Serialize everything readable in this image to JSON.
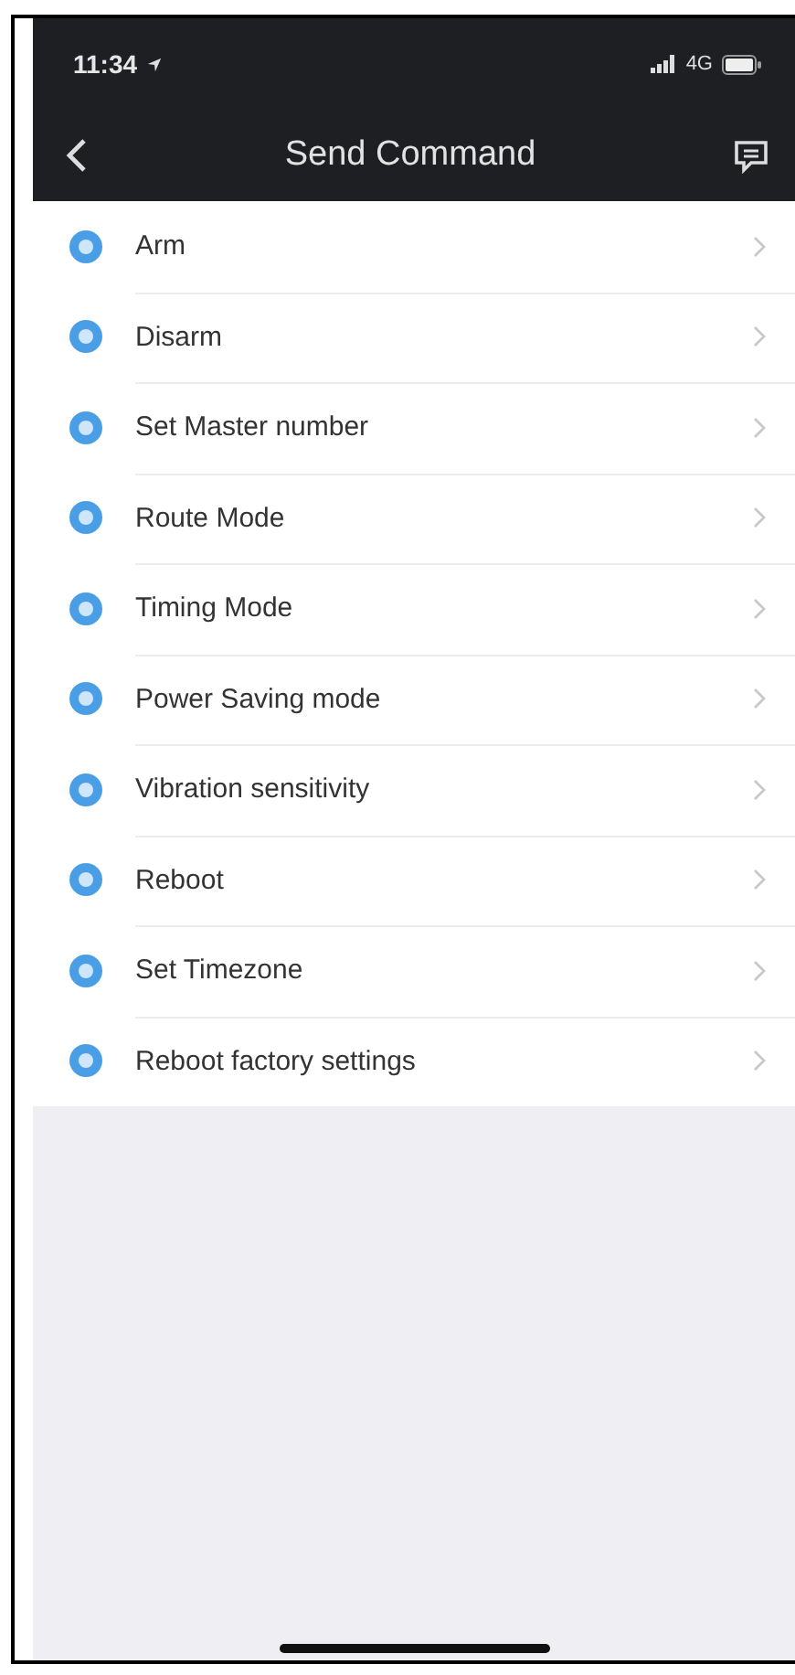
{
  "status_bar": {
    "time": "11:34",
    "network": "4G"
  },
  "nav_bar": {
    "title": "Send Command"
  },
  "commands": [
    {
      "label": "Arm"
    },
    {
      "label": "Disarm"
    },
    {
      "label": "Set Master number"
    },
    {
      "label": "Route Mode"
    },
    {
      "label": "Timing Mode"
    },
    {
      "label": "Power Saving mode"
    },
    {
      "label": "Vibration sensitivity"
    },
    {
      "label": "Reboot"
    },
    {
      "label": "Set Timezone"
    },
    {
      "label": "Reboot factory settings"
    }
  ]
}
